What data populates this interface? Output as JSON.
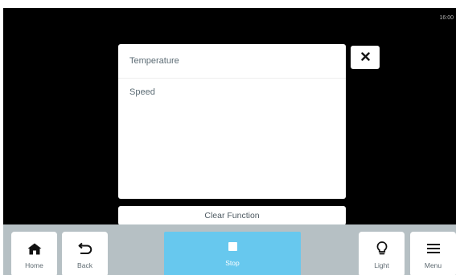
{
  "status_bar": {
    "time": "16:00"
  },
  "dialog": {
    "options": [
      {
        "label": "Temperature"
      },
      {
        "label": "Speed"
      }
    ],
    "clear_label": "Clear Function",
    "close_icon": "close-icon"
  },
  "nav": {
    "home": {
      "label": "Home",
      "icon": "home-icon"
    },
    "back": {
      "label": "Back",
      "icon": "back-arrow-icon"
    },
    "stop": {
      "label": "Stop",
      "icon": "stop-icon"
    },
    "light": {
      "label": "Light",
      "icon": "lightbulb-icon"
    },
    "menu": {
      "label": "Menu",
      "icon": "menu-icon"
    }
  },
  "colors": {
    "screen_bg": "#000000",
    "bar_bg": "#b6c0c4",
    "stop_accent": "#67c8ee",
    "text": "#5b6b74"
  }
}
